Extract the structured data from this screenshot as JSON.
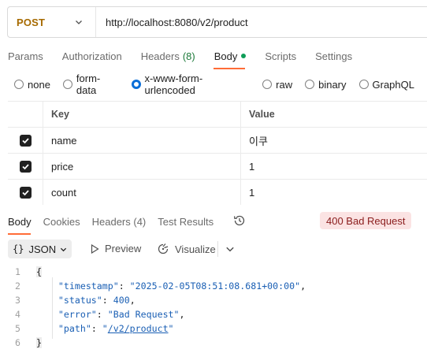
{
  "request": {
    "method": "POST",
    "url": "http://localhost:8080/v2/product"
  },
  "request_tabs": [
    {
      "label": "Params"
    },
    {
      "label": "Authorization"
    },
    {
      "label": "Headers",
      "count": "(8)"
    },
    {
      "label": "Body",
      "active": true
    },
    {
      "label": "Scripts"
    },
    {
      "label": "Settings"
    }
  ],
  "body_types": [
    {
      "label": "none",
      "checked": false
    },
    {
      "label": "form-data",
      "checked": false
    },
    {
      "label": "x-www-form-urlencoded",
      "checked": true
    },
    {
      "label": "raw",
      "checked": false
    },
    {
      "label": "binary",
      "checked": false
    },
    {
      "label": "GraphQL",
      "checked": false
    }
  ],
  "params_table": {
    "headers": {
      "key": "Key",
      "value": "Value"
    },
    "rows": [
      {
        "key": "name",
        "value": "이쿠",
        "enabled": true
      },
      {
        "key": "price",
        "value": "1",
        "enabled": true
      },
      {
        "key": "count",
        "value": "1",
        "enabled": true
      }
    ]
  },
  "response_tabs": [
    {
      "label": "Body",
      "active": true
    },
    {
      "label": "Cookies"
    },
    {
      "label": "Headers",
      "count": "(4)"
    },
    {
      "label": "Test Results"
    }
  ],
  "response_status": "400 Bad Request",
  "format": {
    "selected": "JSON",
    "preview_label": "Preview",
    "visualize_label": "Visualize"
  },
  "response_body": {
    "line_numbers": [
      "1",
      "2",
      "3",
      "4",
      "5",
      "6"
    ],
    "open_brace": "{",
    "close_brace": "}",
    "timestamp_key": "\"timestamp\"",
    "timestamp_value": "\"2025-02-05T08:51:08.681+00:00\"",
    "status_key": "\"status\"",
    "status_value": "400",
    "error_key": "\"error\"",
    "error_value": "\"Bad Request\"",
    "path_key": "\"path\"",
    "path_value": "/v2/product"
  },
  "colors": {
    "method": "#a66a00",
    "accent": "#ff6c37",
    "radio_checked": "#0b6fd8",
    "status_badge_bg": "#fbe3e3",
    "status_badge_text": "#8a1c1c",
    "json_value": "#1a5fb4"
  }
}
